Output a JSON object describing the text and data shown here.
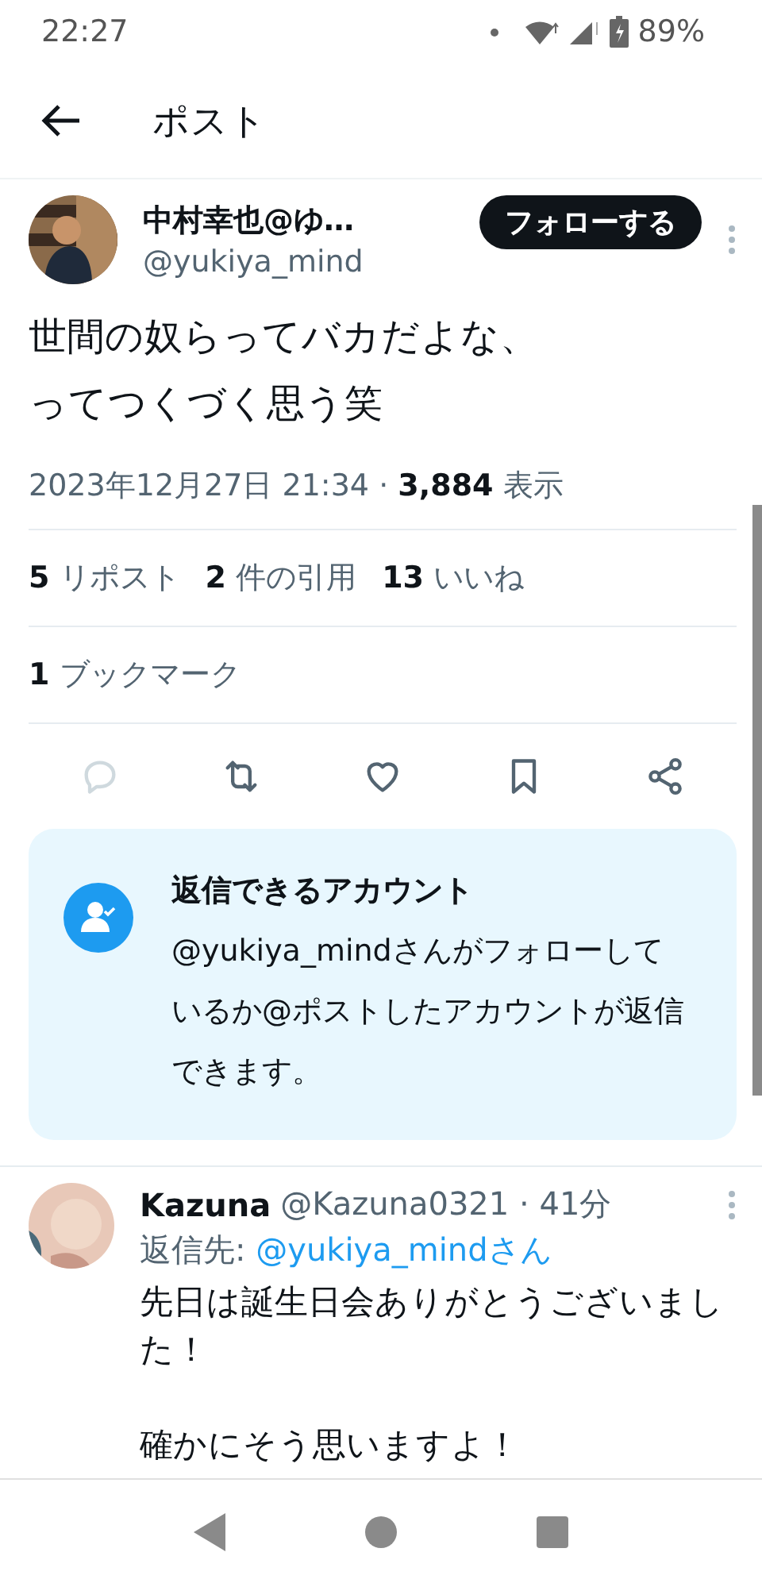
{
  "status_bar": {
    "time": "22:27",
    "battery": "89%"
  },
  "header": {
    "title": "ポスト"
  },
  "post": {
    "author": {
      "name": "中村幸也@ゆ…",
      "handle": "@yukiya_mind"
    },
    "follow_button": "フォローする",
    "text_lines": [
      "世間の奴らってバカだよな、",
      "ってつくづく思う笑"
    ],
    "timestamp": "2023年12月27日 21:34",
    "separator": "·",
    "views": {
      "count": "3,884",
      "label": "表示"
    },
    "stats": [
      {
        "count": "5",
        "label": "リポスト"
      },
      {
        "count": "2",
        "label": "件の引用"
      },
      {
        "count": "13",
        "label": "いいね"
      }
    ],
    "bookmarks": {
      "count": "1",
      "label": "ブックマーク"
    },
    "actions": [
      {
        "kind": "reply",
        "disabled": true
      },
      {
        "kind": "repost",
        "disabled": false
      },
      {
        "kind": "like",
        "disabled": false
      },
      {
        "kind": "bookmark",
        "disabled": false
      },
      {
        "kind": "share",
        "disabled": false
      }
    ]
  },
  "reply_notice": {
    "title": "返信できるアカウント",
    "text": "@yukiya_mindさんがフォローしているか@ポストしたアカウントが返信できます。"
  },
  "replies": [
    {
      "name": "Kazuna",
      "handle": "@Kazuna0321",
      "separator": "·",
      "time": "41分",
      "reply_to_label": "返信先:",
      "reply_to": "@yukiya_mindさん",
      "paragraphs": [
        "先日は誕生日会ありがとうございました！",
        "確かにそう思いますよ！"
      ]
    }
  ]
}
